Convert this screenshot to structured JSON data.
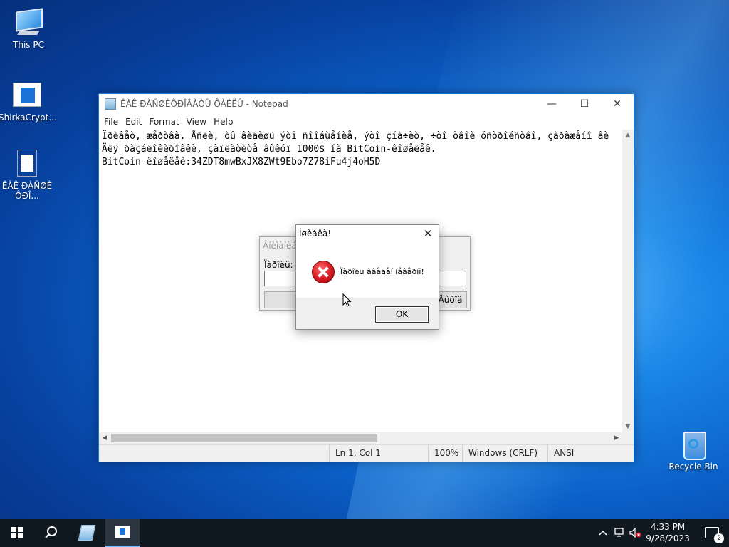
{
  "desktop": {
    "icons": [
      {
        "label": "This PC"
      },
      {
        "label": "ShirkaCrypt..."
      },
      {
        "label": "ÊÀÊ ÐÀÑØÈÔÐÎ..."
      },
      {
        "label": "Recycle Bin"
      }
    ]
  },
  "notepad": {
    "title": "ÊÀÊ ÐÀÑØÈÔÐÎÂÀÒÜ ÔÀÉËÛ - Notepad",
    "menu": [
      "File",
      "Edit",
      "Format",
      "View",
      "Help"
    ],
    "content": "Ïðèâåò, æåðòâà. Åñëè, òû âèäèøü ýòî ñîîáùåíèå, ýòî çíà÷èò, ÷òî òâîè óñòðîéñòâî, çàðàæåíî âè\nÄëÿ ðàçáëîêèðîâêè, çàïëàòèòå âûêóï 1000$ íà BitCoin-êîøåëåê.\nBitCoin-êîøåëåê:34ZDT8mwBxJX8ZWt9Ebo7Z78iFu4j4oH5D",
    "status": {
      "position": "Ln 1, Col 1",
      "zoom": "100%",
      "line_ending": "Windows (CRLF)",
      "encoding": "ANSI"
    }
  },
  "back_dialog": {
    "title": "Âíèìàíèå!",
    "label": "Ïàðîëü:",
    "button": "Âûõîä"
  },
  "error_dialog": {
    "title": "Îøèáêà!",
    "message": "Ïàðîëü ââåäåí íåâåðíî!",
    "ok_label": "OK"
  },
  "taskbar": {
    "time": "4:33 PM",
    "date": "9/28/2023",
    "notifications": "2"
  }
}
